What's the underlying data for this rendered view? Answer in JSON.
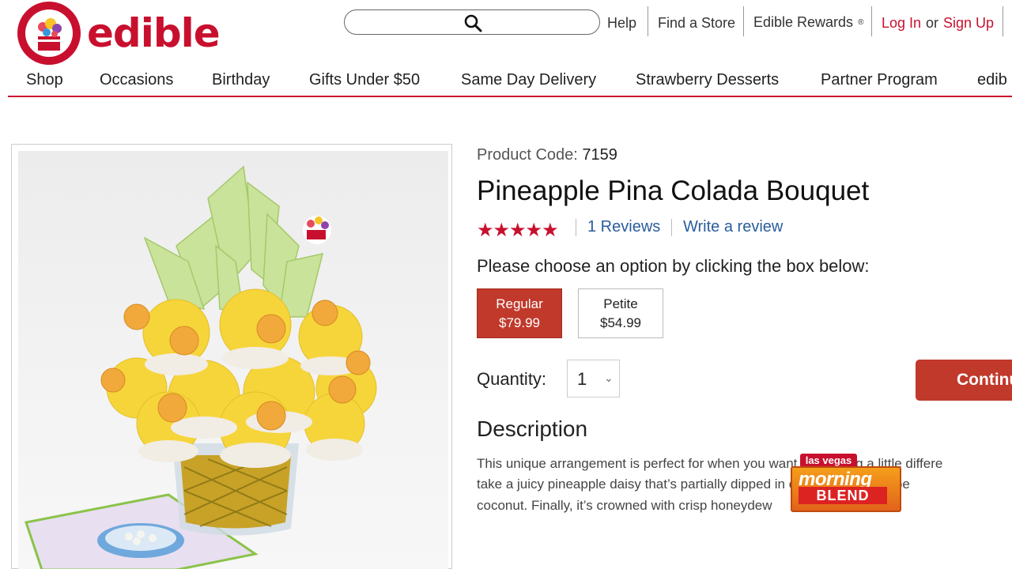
{
  "brand": {
    "name": "edible",
    "color": "#c8102e"
  },
  "search": {
    "placeholder": ""
  },
  "utility": {
    "help": "Help",
    "find_store": "Find a Store",
    "rewards": "Edible Rewards",
    "rewards_mark": "®",
    "login": "Log In",
    "or": "or",
    "signup": "Sign Up"
  },
  "nav": {
    "items": [
      "Shop",
      "Occasions",
      "Birthday",
      "Gifts Under $50",
      "Same Day Delivery",
      "Strawberry Desserts",
      "Partner Program",
      "edib"
    ]
  },
  "product": {
    "code_label": "Product Code:",
    "code": "7159",
    "title": "Pineapple Pina Colada Bouquet",
    "rating": 5,
    "stars": "★★★★★",
    "reviews": "1 Reviews",
    "write_review": "Write a review",
    "choose_text": "Please choose an option by clicking the box below:",
    "options": [
      {
        "name": "Regular",
        "price": "$79.99",
        "selected": true
      },
      {
        "name": "Petite",
        "price": "$54.99",
        "selected": false
      }
    ],
    "quantity_label": "Quantity:",
    "quantity": "1",
    "continue": "Continue",
    "description_heading": "Description",
    "description_lines": [
      "This unique arrangement is perfect for when you want something a little differe",
      "take a juicy pineapple daisy that’s partially dipped in chocolate and toppe",
      "coconut. Finally, it’s crowned with crisp honeydew"
    ]
  },
  "tv_bug": {
    "top": "las vegas",
    "middle": "morning",
    "bottom": "BLEND"
  },
  "colors": {
    "accent": "#c0392b",
    "link": "#2a5d9b",
    "bug_orange": "#f59e1a"
  }
}
